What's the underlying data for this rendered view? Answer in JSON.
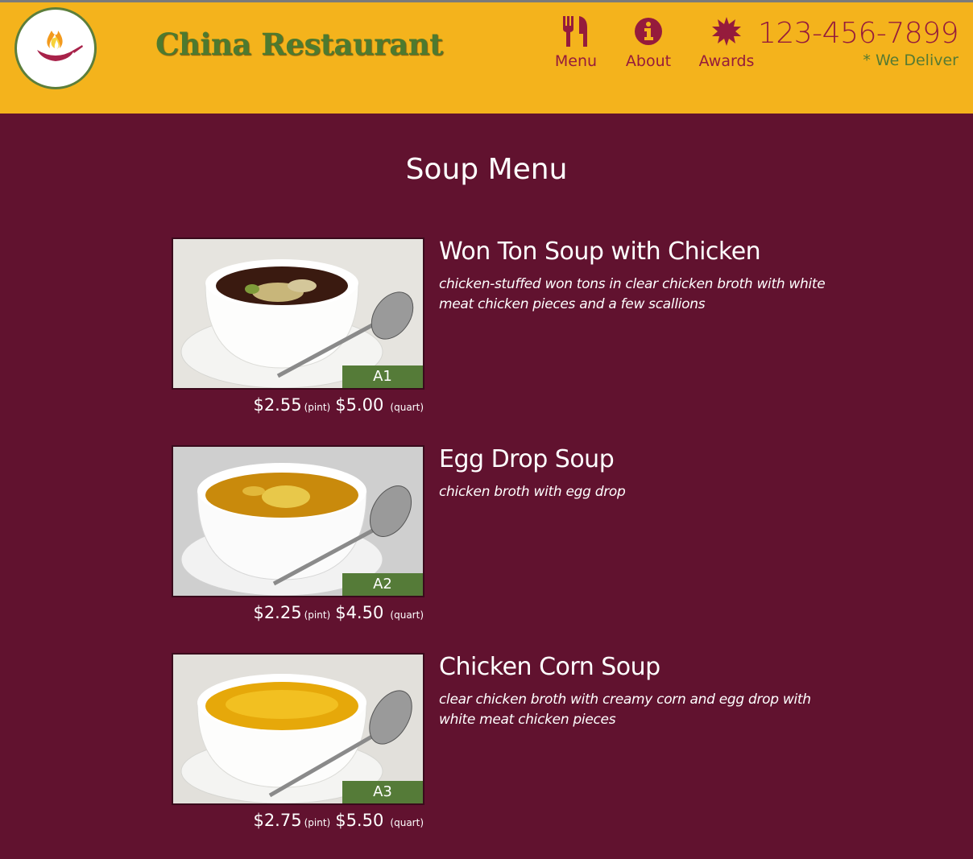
{
  "header": {
    "brand": "China Restaurant",
    "nav": [
      {
        "label": "Menu",
        "icon": "utensils-icon"
      },
      {
        "label": "About",
        "icon": "info-icon"
      },
      {
        "label": "Awards",
        "icon": "award-icon"
      }
    ],
    "phone": "123-456-7899",
    "delivery_note": "* We Deliver"
  },
  "main": {
    "title": "Soup Menu",
    "items": [
      {
        "code": "A1",
        "name": "Won Ton Soup with Chicken",
        "description": "chicken-stuffed won tons in clear chicken broth with white meat chicken pieces and a few scallions",
        "price_pint": "$2.55",
        "pint_label": "(pint)",
        "price_quart": "$5.00",
        "quart_label": "(quart)"
      },
      {
        "code": "A2",
        "name": "Egg Drop Soup",
        "description": "chicken broth with egg drop",
        "price_pint": "$2.25",
        "pint_label": "(pint)",
        "price_quart": "$4.50",
        "quart_label": "(quart)"
      },
      {
        "code": "A3",
        "name": "Chicken Corn Soup",
        "description": "clear chicken broth with creamy corn and egg drop with white meat chicken pieces",
        "price_pint": "$2.75",
        "pint_label": "(pint)",
        "price_quart": "$5.50",
        "quart_label": "(quart)"
      }
    ]
  },
  "colors": {
    "header_bg": "#f4b31c",
    "page_bg": "#61122f",
    "accent_red": "#951b3c",
    "accent_green": "#557b38"
  }
}
